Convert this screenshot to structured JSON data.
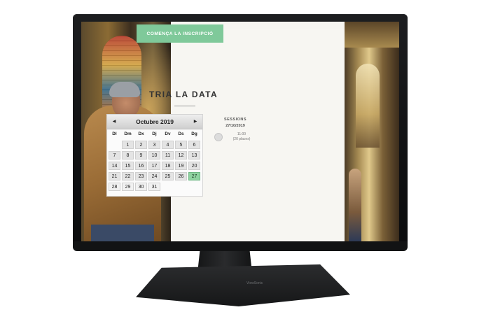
{
  "cta": {
    "label": "COMENÇA LA INSCRIPCIÓ",
    "color": "#7fc99a"
  },
  "heading": {
    "title": "TRIA LA DATA"
  },
  "calendar": {
    "month_label": "Octubre 2019",
    "weekdays": [
      "Dl",
      "Dm",
      "Dx",
      "Dj",
      "Dv",
      "Ds",
      "Dg"
    ],
    "weeks": [
      [
        "",
        "1",
        "2",
        "3",
        "4",
        "5",
        "6"
      ],
      [
        "7",
        "8",
        "9",
        "10",
        "11",
        "12",
        "13"
      ],
      [
        "14",
        "15",
        "16",
        "17",
        "18",
        "19",
        "20"
      ],
      [
        "21",
        "22",
        "23",
        "24",
        "25",
        "26",
        "27"
      ],
      [
        "28",
        "29",
        "30",
        "31",
        "",
        "",
        ""
      ]
    ],
    "selected_day": "27",
    "selected_color": "#8fd3a0"
  },
  "sessions": {
    "label": "SESSIONS",
    "date": "27/10/2019",
    "time": "11:00",
    "places": "(20 places)"
  },
  "monitor": {
    "brand": "ViewSonic"
  }
}
